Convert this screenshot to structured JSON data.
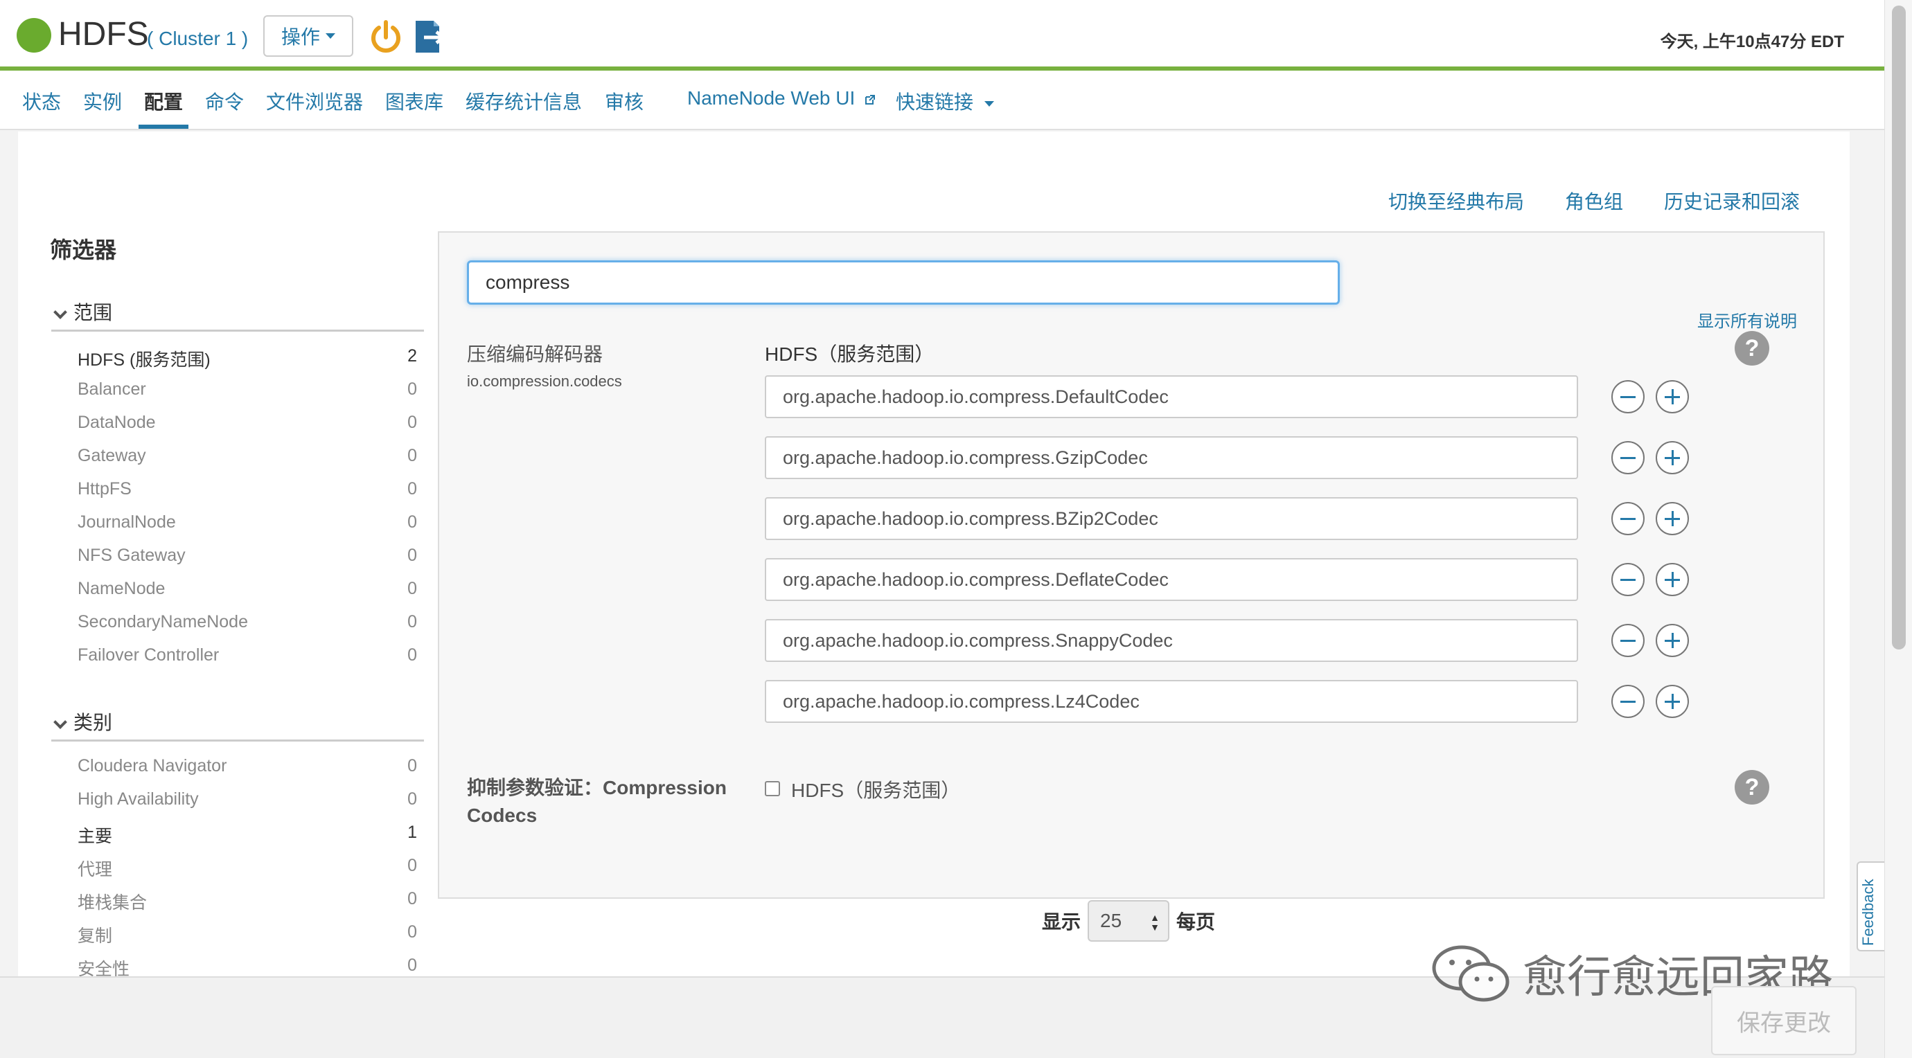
{
  "header": {
    "service_name": "HDFS",
    "cluster": "( Cluster 1 )",
    "actions_label": "操作",
    "time": "今天, 上午10点47分 EDT"
  },
  "nav": {
    "items": [
      {
        "label": "状态"
      },
      {
        "label": "实例"
      },
      {
        "label": "配置"
      },
      {
        "label": "命令"
      },
      {
        "label": "文件浏览器"
      },
      {
        "label": "图表库"
      },
      {
        "label": "缓存统计信息"
      },
      {
        "label": "审核"
      },
      {
        "label": "NameNode Web UI"
      },
      {
        "label": "快速链接"
      }
    ],
    "active": "配置"
  },
  "top_links": {
    "classic": "切换至经典布局",
    "role_groups": "角色组",
    "history": "历史记录和回滚"
  },
  "filter": {
    "title": "筛选器",
    "scope": {
      "title": "范围",
      "items": [
        {
          "label": "HDFS (服务范围)",
          "count": "2"
        },
        {
          "label": "Balancer",
          "count": "0"
        },
        {
          "label": "DataNode",
          "count": "0"
        },
        {
          "label": "Gateway",
          "count": "0"
        },
        {
          "label": "HttpFS",
          "count": "0"
        },
        {
          "label": "JournalNode",
          "count": "0"
        },
        {
          "label": "NFS Gateway",
          "count": "0"
        },
        {
          "label": "NameNode",
          "count": "0"
        },
        {
          "label": "SecondaryNameNode",
          "count": "0"
        },
        {
          "label": "Failover Controller",
          "count": "0"
        }
      ]
    },
    "category": {
      "title": "类别",
      "items": [
        {
          "label": "Cloudera Navigator",
          "count": "0"
        },
        {
          "label": "High Availability",
          "count": "0"
        },
        {
          "label": "主要",
          "count": "1"
        },
        {
          "label": "代理",
          "count": "0"
        },
        {
          "label": "堆栈集合",
          "count": "0"
        },
        {
          "label": "复制",
          "count": "0"
        },
        {
          "label": "安全性",
          "count": "0"
        }
      ]
    }
  },
  "config": {
    "search_value": "compress",
    "show_all_desc": "显示所有说明",
    "property_name": "压缩编码解码器",
    "property_key": "io.compression.codecs",
    "scope_label": "HDFS（服务范围）",
    "codecs": [
      "org.apache.hadoop.io.compress.DefaultCodec",
      "org.apache.hadoop.io.compress.GzipCodec",
      "org.apache.hadoop.io.compress.BZip2Codec",
      "org.apache.hadoop.io.compress.DeflateCodec",
      "org.apache.hadoop.io.compress.SnappyCodec",
      "org.apache.hadoop.io.compress.Lz4Codec"
    ],
    "suppress_label": "抑制参数验证：Compression Codecs",
    "suppress_scope": "HDFS（服务范围）"
  },
  "pager": {
    "show": "显示",
    "per_page_value": "25",
    "per_page": "每页"
  },
  "footer": {
    "save": "保存更改",
    "watermark": "愈行愈远回家路",
    "feedback": "Feedback"
  },
  "colors": {
    "accent": "#2479a8",
    "status_ok": "#6aab2e",
    "header_rule": "#78b13f",
    "power_icon": "#e9a11f",
    "exit_icon": "#2a6ea0"
  }
}
